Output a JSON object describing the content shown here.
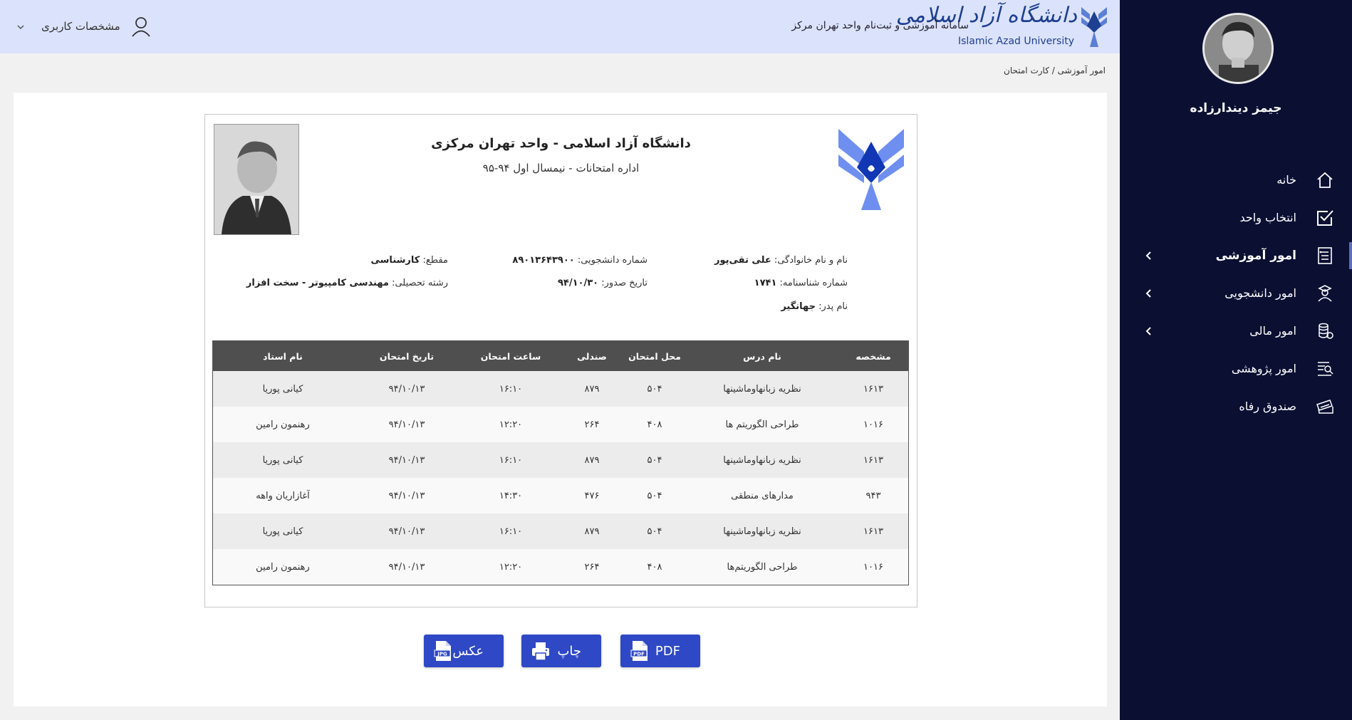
{
  "header": {
    "logo_script": "دانشگاه آزاد اسلامی",
    "logo_en": "Islamic Azad University",
    "system_title": "سامانه آموزشی و ثبت‌نام واحد تهران مرکز",
    "user_menu_label": "مشخصات کاربری"
  },
  "breadcrumb": {
    "parent": "امور آموزشی",
    "separator": "/",
    "current": "کارت امتحان"
  },
  "sidebar": {
    "user_name": "جیمز دیندارزاده",
    "items": [
      {
        "label": "خانه",
        "icon": "home-icon",
        "has_submenu": false,
        "active": false
      },
      {
        "label": "انتخاب واحد",
        "icon": "checkbox-icon",
        "has_submenu": false,
        "active": false
      },
      {
        "label": "امور آموزشی",
        "icon": "document-list-icon",
        "has_submenu": true,
        "active": true
      },
      {
        "label": "امور دانشجویی",
        "icon": "student-icon",
        "has_submenu": true,
        "active": false
      },
      {
        "label": "امور مالی",
        "icon": "coins-icon",
        "has_submenu": true,
        "active": false
      },
      {
        "label": "امور پژوهشی",
        "icon": "research-icon",
        "has_submenu": false,
        "active": false
      },
      {
        "label": "صندوق رفاه",
        "icon": "cards-icon",
        "has_submenu": false,
        "active": false
      }
    ]
  },
  "card": {
    "university": "دانشگاه آزاد اسلامی - واحد تهران مرکزی",
    "subtitle": "اداره امتحانات - نیمسال اول ۹۴-۹۵",
    "fields": {
      "name_label": "نام و نام خانوادگی:",
      "name_value": "علی تقی‌پور",
      "id_number_label": "شماره شناسنامه:",
      "id_number_value": "۱۷۴۱",
      "father_label": "نام پدر:",
      "father_value": "جهانگیر",
      "student_no_label": "شماره دانشجویی:",
      "student_no_value": "۸۹۰۱۳۶۴۳۹۰۰",
      "issue_date_label": "تاریخ صدور:",
      "issue_date_value": "۹۴/۱۰/۳۰",
      "level_label": "مقطع:",
      "level_value": "کارشناسی",
      "major_label": "رشته تحصیلی:",
      "major_value": "مهندسی کامپیوتر - سخت افزار"
    },
    "table": {
      "headers": [
        "مشخصه",
        "نام درس",
        "محل امتحان",
        "صندلی",
        "ساعت امتحان",
        "تاریخ امتحان",
        "نام استاد"
      ],
      "rows": [
        [
          "۱۶۱۳",
          "نظریه زبانهاوماشینها",
          "۵۰۴",
          "۸۷۹",
          "۱۶:۱۰",
          "۹۴/۱۰/۱۳",
          "کیانی پوریا"
        ],
        [
          "۱۰۱۶",
          "طراحی الگوریتم  ها",
          "۴۰۸",
          "۲۶۴",
          "۱۲:۲۰",
          "۹۴/۱۰/۱۳",
          "رهنمون رامین"
        ],
        [
          "۱۶۱۳",
          "نظریه زبانهاوماشینها",
          "۵۰۴",
          "۸۷۹",
          "۱۶:۱۰",
          "۹۴/۱۰/۱۳",
          "کیانی پوریا"
        ],
        [
          "۹۴۳",
          "مدارهای منطقی",
          "۵۰۴",
          "۴۷۶",
          "۱۴:۳۰",
          "۹۴/۱۰/۱۳",
          "آغازاریان واهه"
        ],
        [
          "۱۶۱۳",
          "نظریه زبانهاوماشینها",
          "۵۰۴",
          "۸۷۹",
          "۱۶:۱۰",
          "۹۴/۱۰/۱۳",
          "کیانی پوریا"
        ],
        [
          "۱۰۱۶",
          "طراحی الگوریتم‌ها",
          "۴۰۸",
          "۲۶۴",
          "۱۲:۲۰",
          "۹۴/۱۰/۱۳",
          "رهنمون رامین"
        ]
      ]
    }
  },
  "actions": {
    "pdf_label": "PDF",
    "print_label": "چاپ",
    "image_label": "عکس",
    "pdf_icon_text": "PDF",
    "jpg_icon_text": "JPG"
  },
  "colors": {
    "sidebar_bg": "#0b1033",
    "header_bg": "#dbe2fb",
    "button_bg": "#2f48c5",
    "table_header_bg": "#4f4f4f",
    "logo_blue": "#1e3f92"
  }
}
